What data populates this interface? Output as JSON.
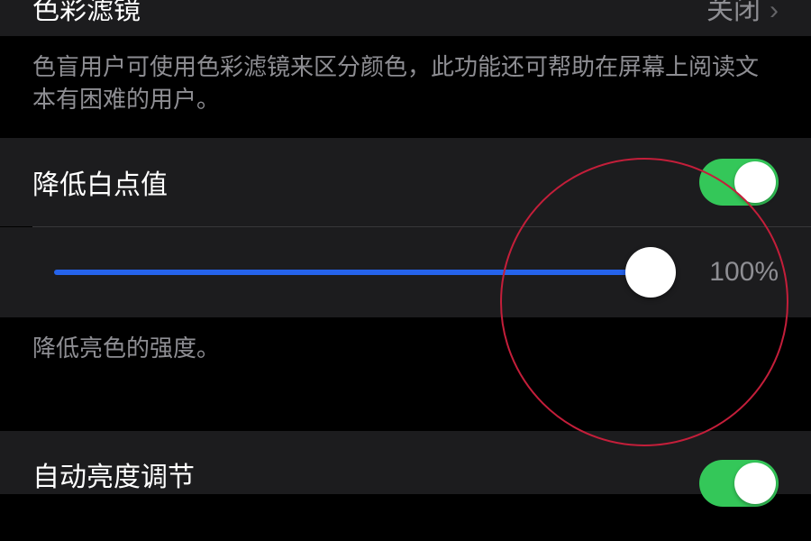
{
  "rows": {
    "colorFilter": {
      "label": "色彩滤镜",
      "value": "关闭"
    },
    "colorFilterDesc": "色盲用户可使用色彩滤镜来区分颜色，此功能还可帮助在屏幕上阅读文本有困难的用户。",
    "whitePoint": {
      "label": "降低白点值",
      "enabled": true,
      "sliderValue": 100,
      "sliderDisplay": "100%"
    },
    "whitePointDesc": "降低亮色的强度。",
    "autoBrightness": {
      "label": "自动亮度调节",
      "enabled": true
    }
  },
  "colors": {
    "toggleOn": "#34c759",
    "sliderTrack": "#2563eb",
    "highlight": "#c41e3a"
  }
}
